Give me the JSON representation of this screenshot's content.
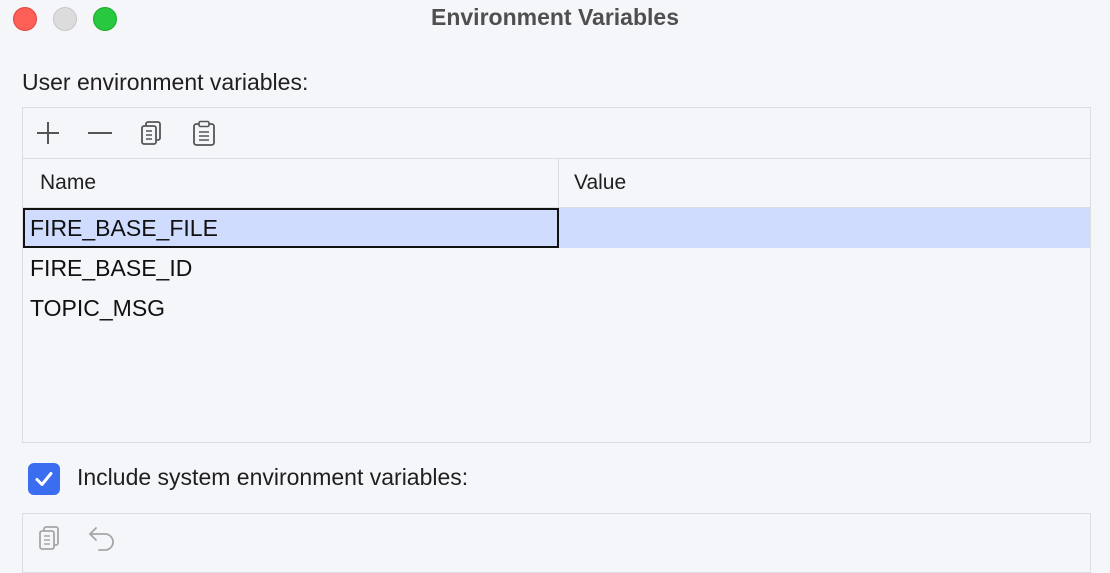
{
  "window": {
    "title": "Environment Variables",
    "buttons": [
      "close",
      "minimize",
      "maximize"
    ]
  },
  "user_vars": {
    "label": "User environment variables:",
    "toolbar": {
      "icons": [
        "plus-icon",
        "minus-icon",
        "copy-icon",
        "paste-icon"
      ]
    },
    "table": {
      "columns": [
        "Name",
        "Value"
      ],
      "rows": [
        {
          "name": "FIRE_BASE_FILE",
          "value": "",
          "selected": true
        },
        {
          "name": "FIRE_BASE_ID",
          "value": "",
          "selected": false
        },
        {
          "name": "TOPIC_MSG",
          "value": "",
          "selected": false
        }
      ]
    }
  },
  "system_vars": {
    "checkbox_label": "Include system environment variables:",
    "checked": true,
    "toolbar": {
      "icons": [
        "copy-icon",
        "undo-icon"
      ]
    }
  },
  "colors": {
    "selection": "#cfdcfd",
    "accent": "#3a6df0",
    "close": "#fe5f57",
    "maximize": "#28c840"
  }
}
